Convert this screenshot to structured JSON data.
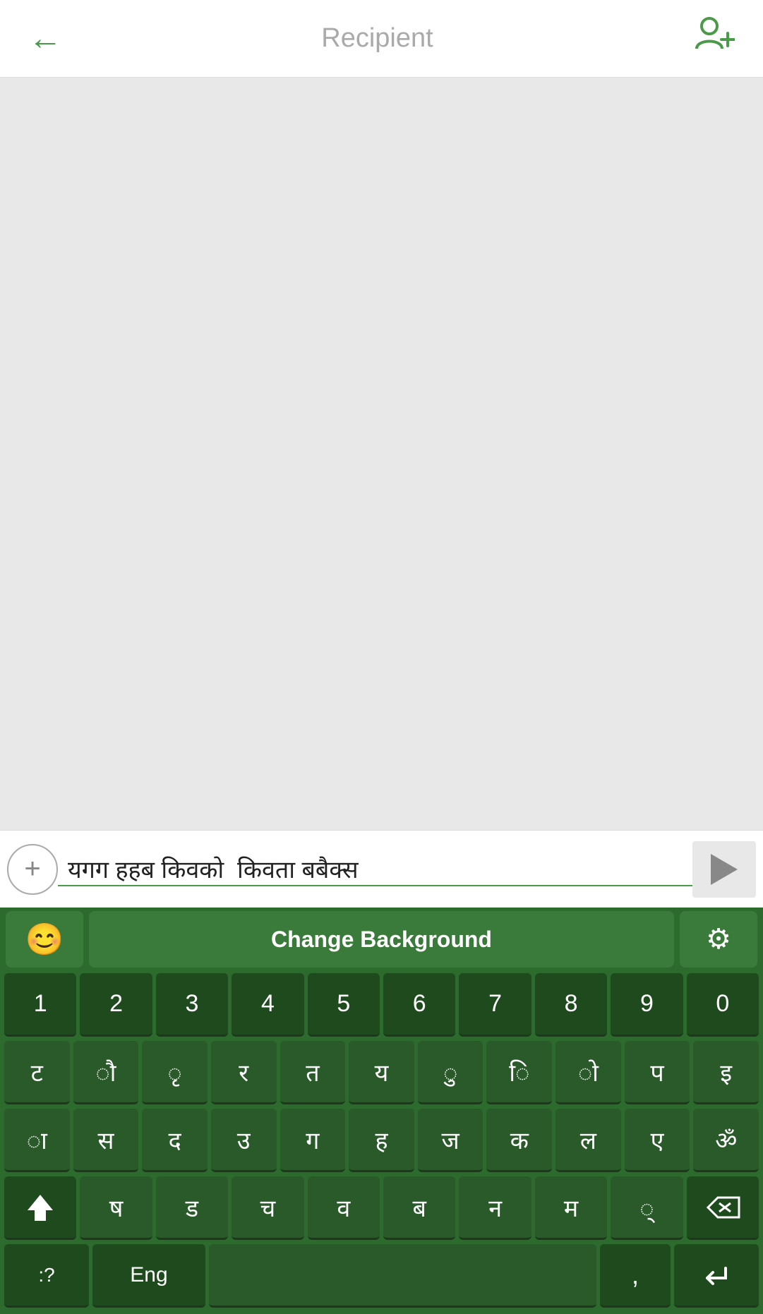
{
  "header": {
    "title": "Recipient",
    "back_label": "←",
    "add_contact_label": "👤+"
  },
  "input_row": {
    "add_button_label": "+",
    "input_text": "यगग हहब किवको  किवता ब‍बैक्स",
    "input_placeholder": "",
    "send_button_label": "▶"
  },
  "keyboard": {
    "topbar": {
      "emoji_label": "😊",
      "change_background_label": "Change Background",
      "settings_label": "⚙"
    },
    "number_row": [
      "1",
      "2",
      "3",
      "4",
      "5",
      "6",
      "7",
      "8",
      "9",
      "0"
    ],
    "row1": [
      "ट",
      "ौ",
      "ृ",
      "र",
      "त",
      "य",
      "ु",
      "ि",
      "ो",
      "प",
      "इ"
    ],
    "row2": [
      "ा",
      "स",
      "द",
      "उ",
      "ग",
      "ह",
      "ज",
      "क",
      "ल",
      "ए",
      "ॐ"
    ],
    "row3_start": [
      "⇧"
    ],
    "row3": [
      "ष",
      "ड",
      "च",
      "व",
      "ब",
      "न",
      "म",
      "्"
    ],
    "row3_end": [
      "⌫"
    ],
    "bottom": {
      "sym": ":?",
      "eng": "Eng",
      "space": "",
      "comma": ",",
      "enter": "↵"
    }
  },
  "colors": {
    "accent_green": "#4a9a4a",
    "keyboard_dark": "#2d6a2d",
    "key_bg": "#2a5a2a",
    "key_special_bg": "#1e4a1e"
  }
}
